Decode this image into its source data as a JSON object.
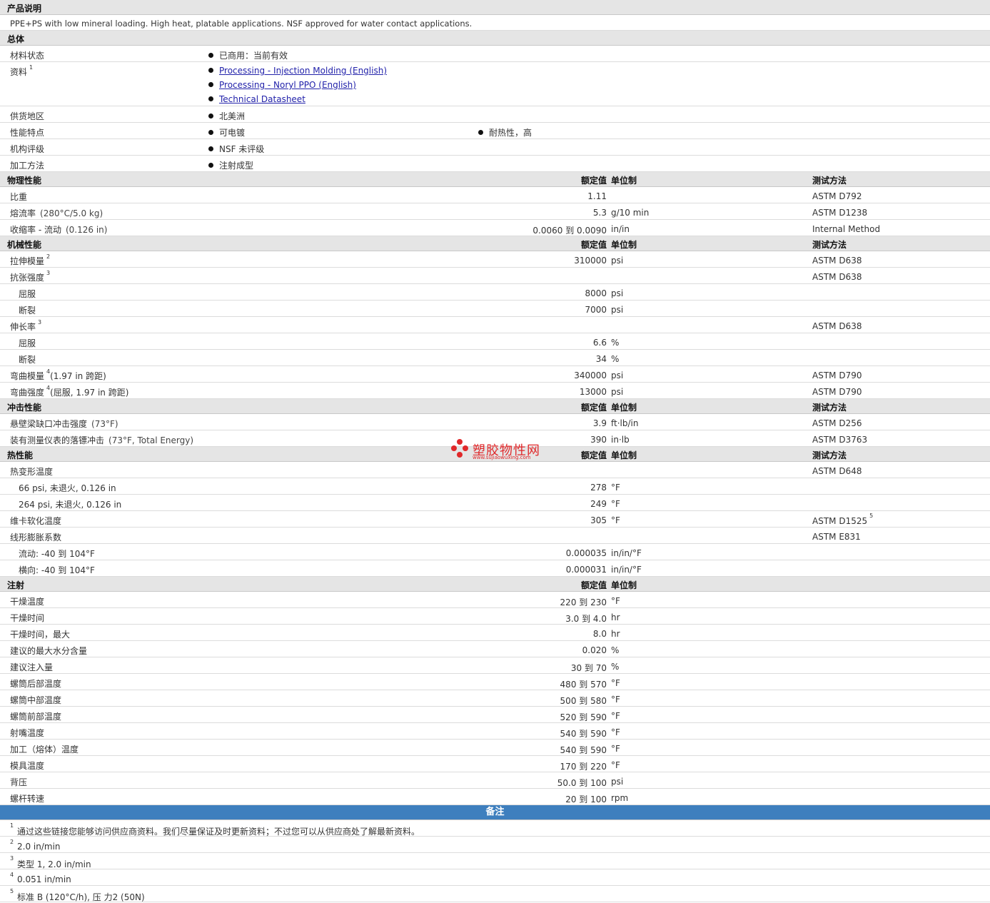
{
  "desc_header": "产品说明",
  "description": "PPE+PS with low mineral loading. High heat, platable applications. NSF approved for water contact applications.",
  "general": {
    "header": "总体",
    "material_status": {
      "label": "材料状态",
      "value": "已商用：当前有效"
    },
    "documents": {
      "label": "资料",
      "sup": "1",
      "links": [
        "Processing - Injection Molding (English)",
        "Processing - Noryl PPO (English)",
        "Technical Datasheet"
      ]
    },
    "supply_region": {
      "label": "供货地区",
      "value": "北美洲"
    },
    "features": {
      "label": "性能特点",
      "values": [
        "可电镀",
        "耐热性，高"
      ]
    },
    "agency": {
      "label": "机构评级",
      "value": "NSF 未评级"
    },
    "processing": {
      "label": "加工方法",
      "value": "注射成型"
    }
  },
  "columns": {
    "nominal": "额定值",
    "unit": "单位制",
    "method": "测试方法"
  },
  "physical": {
    "header": "物理性能",
    "rows": [
      {
        "label": "比重",
        "cond": "",
        "value": "1.11",
        "unit": "",
        "method": "ASTM D792"
      },
      {
        "label": "熔流率",
        "cond": "(280°C/5.0 kg)",
        "value": "5.3",
        "unit": "g/10 min",
        "method": "ASTM D1238"
      },
      {
        "label": "收缩率 - 流动",
        "cond": "(0.126 in)",
        "value": "0.0060 到  0.0090",
        "unit": "in/in",
        "method": "Internal Method"
      }
    ]
  },
  "mechanical": {
    "header": "机械性能",
    "tensile_modulus": {
      "label": "拉伸模量",
      "sup": "2",
      "value": "310000",
      "unit": "psi",
      "method": "ASTM D638"
    },
    "tensile_strength": {
      "label": "抗张强度",
      "sup": "3",
      "method": "ASTM D638",
      "yield": {
        "label": "屈服",
        "value": "8000",
        "unit": "psi"
      },
      "break": {
        "label": "断裂",
        "value": "7000",
        "unit": "psi"
      }
    },
    "elongation": {
      "label": "伸长率",
      "sup": "3",
      "method": "ASTM D638",
      "yield": {
        "label": "屈服",
        "value": "6.6",
        "unit": "%"
      },
      "break": {
        "label": "断裂",
        "value": "34",
        "unit": "%"
      }
    },
    "flex_modulus": {
      "label": "弯曲模量",
      "sup": "4",
      "cond": "(1.97 in 跨距)",
      "value": "340000",
      "unit": "psi",
      "method": "ASTM D790"
    },
    "flex_strength": {
      "label": "弯曲强度",
      "sup": "4",
      "cond": "(屈服, 1.97 in 跨距)",
      "value": "13000",
      "unit": "psi",
      "method": "ASTM D790"
    }
  },
  "impact": {
    "header": "冲击性能",
    "rows": [
      {
        "label": "悬壁梁缺口冲击强度",
        "cond": "(73°F)",
        "value": "3.9",
        "unit": "ft·lb/in",
        "method": "ASTM D256"
      },
      {
        "label": "装有测量仪表的落镖冲击",
        "cond": "(73°F, Total Energy)",
        "value": "390",
        "unit": "in·lb",
        "method": "ASTM D3763"
      }
    ]
  },
  "thermal": {
    "header": "热性能",
    "hdt": {
      "label": "热变形温度",
      "method": "ASTM D648",
      "rows": [
        {
          "label": "66 psi, 未退火, 0.126 in",
          "value": "278",
          "unit": "°F"
        },
        {
          "label": "264 psi, 未退火, 0.126 in",
          "value": "249",
          "unit": "°F"
        }
      ]
    },
    "vicat": {
      "label": "维卡软化温度",
      "value": "305",
      "unit": "°F",
      "method": "ASTM D1525",
      "method_sup": "5"
    },
    "clte": {
      "label": "线形膨胀系数",
      "method": "ASTM E831",
      "rows": [
        {
          "label": "流动: -40 到  104°F",
          "value": "0.000035",
          "unit": "in/in/°F"
        },
        {
          "label": "横向: -40 到  104°F",
          "value": "0.000031",
          "unit": "in/in/°F"
        }
      ]
    }
  },
  "injection": {
    "header": "注射",
    "rows": [
      {
        "label": "干燥温度",
        "value": "220 到  230",
        "unit": "°F"
      },
      {
        "label": "干燥时间",
        "value": "3.0 到  4.0",
        "unit": "hr"
      },
      {
        "label": "干燥时间，最大",
        "value": "8.0",
        "unit": "hr"
      },
      {
        "label": "建议的最大水分含量",
        "value": "0.020",
        "unit": "%"
      },
      {
        "label": "建议注入量",
        "value": "30 到  70",
        "unit": "%"
      },
      {
        "label": "螺筒后部温度",
        "value": "480 到  570",
        "unit": "°F"
      },
      {
        "label": "螺筒中部温度",
        "value": "500 到  580",
        "unit": "°F"
      },
      {
        "label": "螺筒前部温度",
        "value": "520 到  590",
        "unit": "°F"
      },
      {
        "label": "射嘴温度",
        "value": "540 到  590",
        "unit": "°F"
      },
      {
        "label": "加工（熔体）温度",
        "value": "540 到  590",
        "unit": "°F"
      },
      {
        "label": "模具温度",
        "value": "170 到  220",
        "unit": "°F"
      },
      {
        "label": "背压",
        "value": "50.0 到  100",
        "unit": "psi"
      },
      {
        "label": "螺杆转速",
        "value": "20 到  100",
        "unit": "rpm"
      }
    ]
  },
  "notes": {
    "header": "备注",
    "items": [
      {
        "n": "1",
        "text": "通过这些链接您能够访问供应商资料。我们尽量保证及时更新资料；不过您可以从供应商处了解最新资料。"
      },
      {
        "n": "2",
        "text": "2.0 in/min"
      },
      {
        "n": "3",
        "text": "类型  1, 2.0 in/min"
      },
      {
        "n": "4",
        "text": "0.051 in/min"
      },
      {
        "n": "5",
        "text": "标准  B (120°C/h), 压  力2 (50N)"
      }
    ]
  },
  "watermark": {
    "name": "塑胶物性网",
    "url": "www.sujiaowuxing.com"
  }
}
